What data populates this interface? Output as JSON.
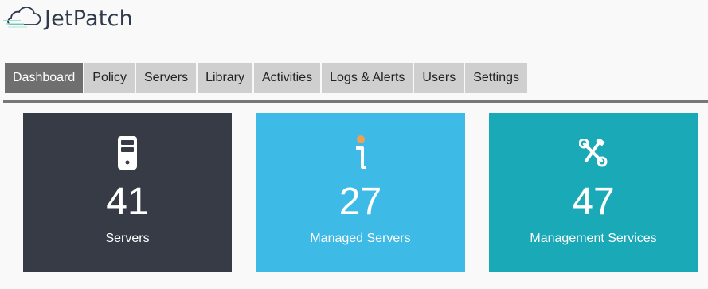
{
  "brand": {
    "name": "JetPatch"
  },
  "tabs": [
    {
      "label": "Dashboard",
      "active": true
    },
    {
      "label": "Policy",
      "active": false
    },
    {
      "label": "Servers",
      "active": false
    },
    {
      "label": "Library",
      "active": false
    },
    {
      "label": "Activities",
      "active": false
    },
    {
      "label": "Logs & Alerts",
      "active": false
    },
    {
      "label": "Users",
      "active": false
    },
    {
      "label": "Settings",
      "active": false
    }
  ],
  "cards": [
    {
      "count": "41",
      "label": "Servers",
      "icon": "server-icon",
      "color": "#363b45"
    },
    {
      "count": "27",
      "label": "Managed Servers",
      "icon": "info-icon",
      "color": "#3dbbe6"
    },
    {
      "count": "47",
      "label": "Management Services",
      "icon": "tools-icon",
      "color": "#1aa9b7"
    }
  ],
  "colors": {
    "active_tab": "#6f6f6f",
    "tab": "#cfcfcf",
    "accent_dot": "#f0a050"
  }
}
